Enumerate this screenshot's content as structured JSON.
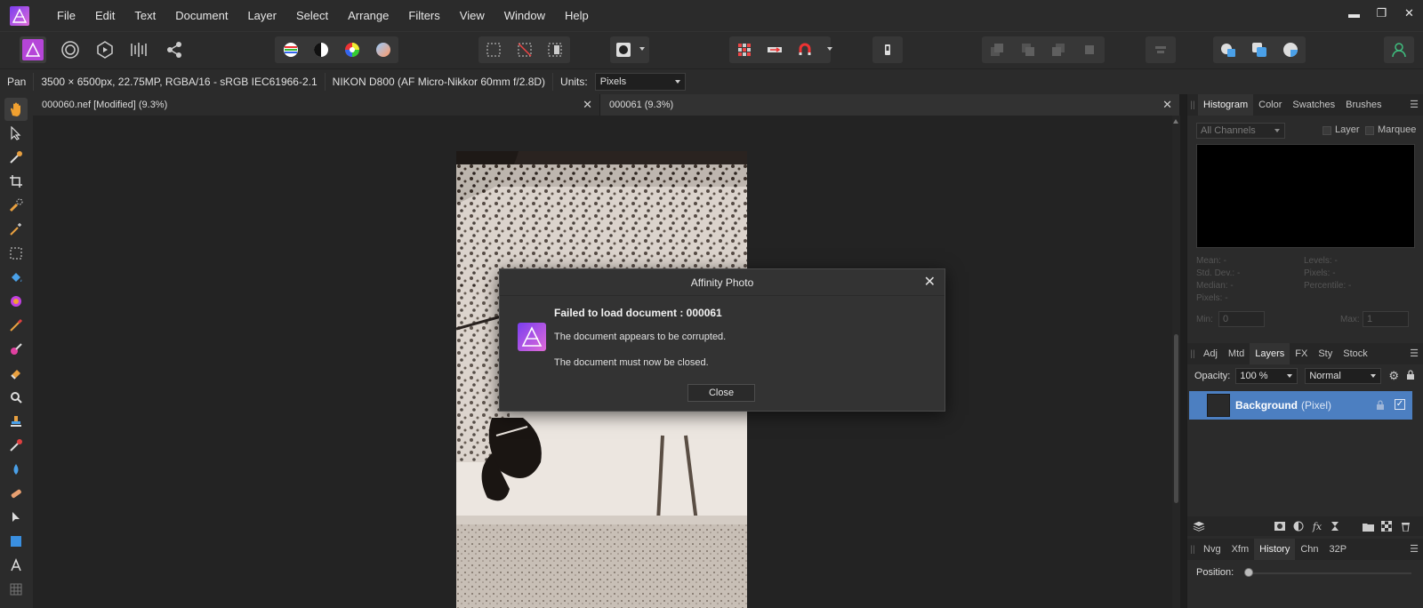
{
  "menu": {
    "items": [
      "File",
      "Edit",
      "Text",
      "Document",
      "Layer",
      "Select",
      "Arrange",
      "Filters",
      "View",
      "Window",
      "Help"
    ]
  },
  "window_controls": {
    "minimize": "▬",
    "restore": "❐",
    "close": "✕"
  },
  "toolbar": {
    "personas": [
      "photo-persona",
      "liquify-persona",
      "develop-persona",
      "tone-mapping-persona",
      "export-persona"
    ],
    "adjustments": [
      "levels",
      "black-and-white",
      "color-wheel",
      "white-balance"
    ]
  },
  "contextbar": {
    "tool": "Pan",
    "doc_info": "3500 × 6500px, 22.75MP, RGBA/16 - sRGB IEC61966-2.1",
    "camera": "NIKON D800 (AF Micro-Nikkor 60mm f/2.8D)",
    "units_label": "Units:",
    "units_value": "Pixels"
  },
  "doc_tabs": [
    {
      "label": "000060.nef [Modified] (9.3%)"
    },
    {
      "label": "000061 (9.3%)"
    }
  ],
  "dialog": {
    "title": "Affinity Photo",
    "heading": "Failed to load document : 000061",
    "message1": "The document appears to be corrupted.",
    "message2": "The document must now be closed.",
    "button": "Close"
  },
  "histogram_panel": {
    "tabs": [
      "Histogram",
      "Color",
      "Swatches",
      "Brushes"
    ],
    "channels": "All Channels",
    "layer_label": "Layer",
    "marquee_label": "Marquee",
    "stats_left": [
      "Mean: -",
      "Std. Dev.: -",
      "Median: -",
      "Pixels: -"
    ],
    "stats_right": [
      "Levels: -",
      "Pixels: -",
      "Percentile: -"
    ],
    "min_label": "Min:",
    "min_value": "0",
    "max_label": "Max:",
    "max_value": "1"
  },
  "layers_panel": {
    "tabs": [
      "Adj",
      "Mtd",
      "Layers",
      "FX",
      "Sty",
      "Stock"
    ],
    "opacity_label": "Opacity:",
    "opacity_value": "100 %",
    "blend_mode": "Normal",
    "layer_name": "Background",
    "layer_type": "(Pixel)"
  },
  "history_panel": {
    "tabs": [
      "Nvg",
      "Xfm",
      "History",
      "Chn",
      "32P"
    ],
    "position_label": "Position:"
  },
  "colors": {
    "accent_selection": "#4c7fc1",
    "brand_purple": "#b545d8"
  }
}
